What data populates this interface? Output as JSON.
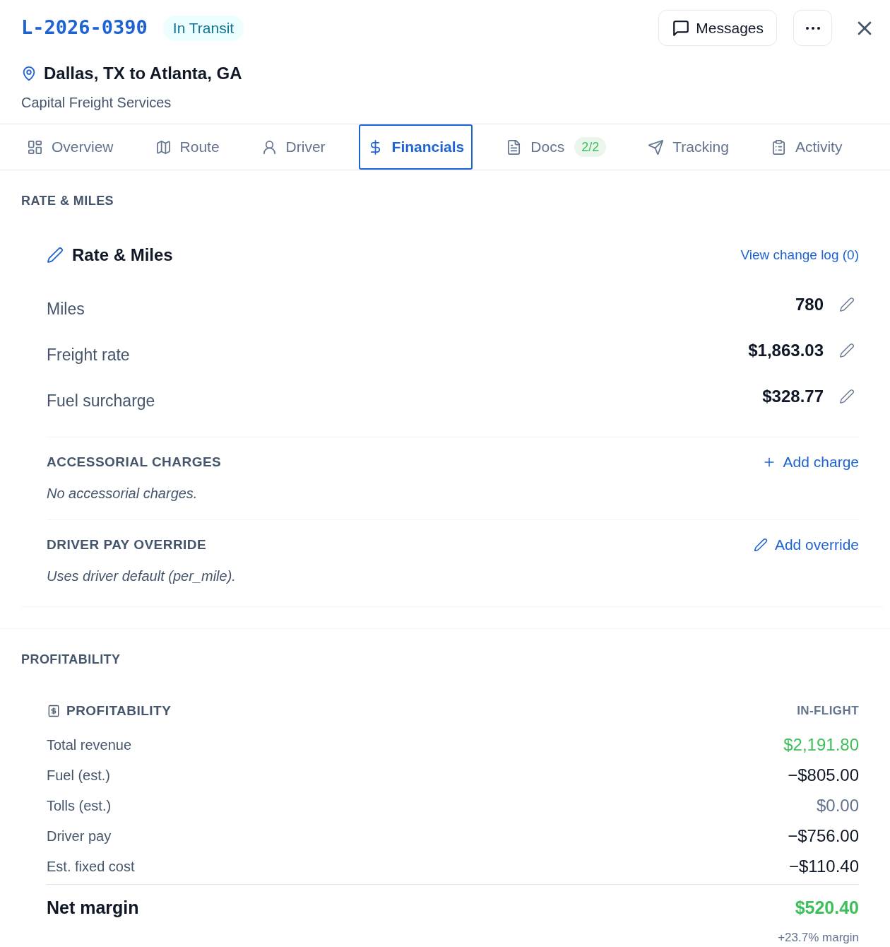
{
  "header": {
    "load_id": "L-2026-0390",
    "status": "In Transit",
    "route": "Dallas, TX to Atlanta, GA",
    "customer": "Capital Freight Services",
    "messages_button": "Messages"
  },
  "tabs": [
    {
      "label": "Overview",
      "selected": false
    },
    {
      "label": "Route",
      "selected": false
    },
    {
      "label": "Driver",
      "selected": false
    },
    {
      "label": "Financials",
      "selected": true
    },
    {
      "label": "Docs",
      "selected": false,
      "badge": "2/2"
    },
    {
      "label": "Tracking",
      "selected": false
    },
    {
      "label": "Activity",
      "selected": false
    }
  ],
  "rate_section": {
    "heading": "RATE & MILES",
    "card": {
      "title": "Rate & Miles",
      "change_log_link": "View change log (0)",
      "fields": [
        {
          "label": "Miles",
          "value": "780"
        },
        {
          "label": "Freight rate",
          "value": "$1,863.03"
        },
        {
          "label": "Fuel surcharge",
          "value": "$328.77"
        }
      ],
      "accessorial": {
        "heading": "ACCESSORIAL CHARGES",
        "action": "Add charge",
        "empty_text": "No accessorial charges."
      },
      "driver_pay_override": {
        "heading": "DRIVER PAY OVERRIDE",
        "action": "Add override",
        "note": "Uses driver default (per_mile)."
      }
    }
  },
  "profitability_section": {
    "heading": "PROFITABILITY",
    "card": {
      "title": "PROFITABILITY",
      "status": "IN-FLIGHT",
      "lines": [
        {
          "label": "Total revenue",
          "value": "$2,191.80",
          "kind": "positive"
        },
        {
          "label": "Fuel (est.)",
          "value": "−$805.00",
          "kind": "negative"
        },
        {
          "label": "Tolls (est.)",
          "value": "$0.00",
          "kind": "neutral"
        },
        {
          "label": "Driver pay",
          "value": "−$756.00",
          "kind": "negative"
        },
        {
          "label": "Est. fixed cost",
          "value": "−$110.40",
          "kind": "negative"
        }
      ],
      "net": {
        "label": "Net margin",
        "value": "$520.40",
        "kind": "positive",
        "note": "+23.7% margin"
      }
    }
  }
}
